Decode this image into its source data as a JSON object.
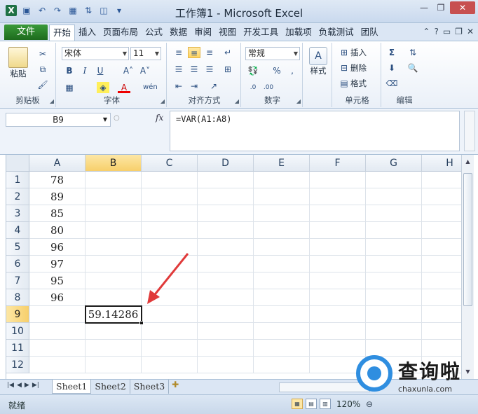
{
  "window": {
    "title": "工作簿1 - Microsoft Excel"
  },
  "ribbon_tabs": {
    "file": "文件",
    "items": [
      "开始",
      "插入",
      "页面布局",
      "公式",
      "数据",
      "审阅",
      "视图",
      "开发工具",
      "加载项",
      "负载测试",
      "团队"
    ],
    "active_index": 0
  },
  "ribbon": {
    "clipboard": {
      "paste": "粘贴",
      "label": "剪贴板"
    },
    "font": {
      "name": "宋体",
      "size": "11",
      "label": "字体",
      "bold": "B",
      "italic": "I",
      "underline": "U",
      "grow": "A˄",
      "shrink": "A˅",
      "wen": "wén"
    },
    "alignment": {
      "label": "对齐方式"
    },
    "number": {
      "format": "常规",
      "label": "数字",
      "percent": "%",
      "comma": ","
    },
    "styles": {
      "label": "样式"
    },
    "cells": {
      "insert": "插入",
      "delete": "删除",
      "format": "格式",
      "label": "单元格"
    },
    "editing": {
      "label": "编辑",
      "sum": "Σ"
    }
  },
  "formula_bar": {
    "name_box": "B9",
    "fx": "fx",
    "formula": "=VAR(A1:A8)"
  },
  "grid": {
    "columns": [
      "A",
      "B",
      "C",
      "D",
      "E",
      "F",
      "G",
      "H"
    ],
    "selected_column": "B",
    "rows": [
      1,
      2,
      3,
      4,
      5,
      6,
      7,
      8,
      9,
      10,
      11,
      12
    ],
    "selected_row": 9,
    "column_a_values": [
      "78",
      "89",
      "85",
      "80",
      "96",
      "97",
      "95",
      "96"
    ],
    "b9_value": "59.14286"
  },
  "sheets": {
    "tabs": [
      "Sheet1",
      "Sheet2",
      "Sheet3"
    ],
    "active_index": 0
  },
  "status": {
    "ready": "就绪",
    "zoom": "120%"
  },
  "watermark": {
    "text": "查询啦",
    "url": "chaxunla.com"
  },
  "colors": {
    "accent": "#217346",
    "selection": "#f7cf6b",
    "arrow": "#e03a3a"
  }
}
